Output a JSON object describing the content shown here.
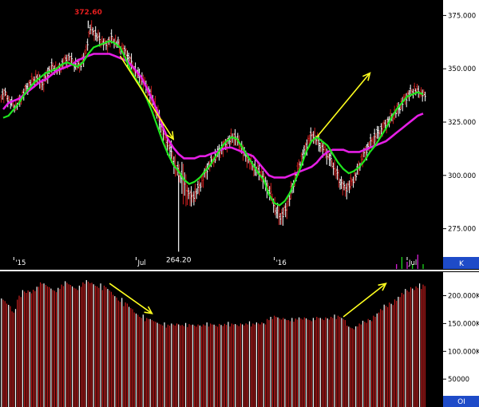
{
  "colors": {
    "background": "#000000",
    "up_bar": "#c81e1e",
    "down_bar": "#ffffff",
    "fast_ma": "#1ee61e",
    "slow_ma": "#e61ee6",
    "arrow": "#ffff1e",
    "axis_panel": "#ffffff",
    "axis_text": "#000000",
    "axis_tag": "#1e4bc8",
    "high_label": "#e61e1e",
    "low_label": "#ffffff",
    "divider": "#ffffff"
  },
  "chart_data": [
    {
      "type": "ohlc",
      "name": "price",
      "grid": false,
      "y_axis_side": "right",
      "ylim": [
        258,
        380
      ],
      "yticks": [
        {
          "value": 375,
          "label": "375.000"
        },
        {
          "value": 350,
          "label": "350.000"
        },
        {
          "value": 325,
          "label": "325.000"
        },
        {
          "value": 300,
          "label": "300.000"
        },
        {
          "value": 275,
          "label": "275.000"
        }
      ],
      "x_ticks": [
        {
          "label": "'15",
          "index": 2
        },
        {
          "label": "Jul",
          "index": 25
        },
        {
          "label": "'16",
          "index": 51
        },
        {
          "label": "Jul",
          "index": 76
        }
      ],
      "axis_tag": "K",
      "annotations": {
        "high": {
          "label": "372.60",
          "value": 372.6,
          "index": 16
        },
        "low": {
          "label": "264.20",
          "value": 264.2,
          "index": 33
        }
      },
      "close": [
        338,
        334,
        332,
        336,
        341,
        344,
        346,
        342,
        348,
        351,
        349,
        353,
        355,
        352,
        351,
        356,
        369,
        366,
        363,
        361,
        364,
        362,
        359,
        356,
        351,
        347,
        344,
        339,
        334,
        326,
        318,
        312,
        304,
        300,
        293,
        289,
        292,
        297,
        303,
        307,
        310,
        313,
        316,
        318,
        315,
        310,
        306,
        303,
        301,
        296,
        291,
        283,
        280,
        285,
        294,
        302,
        309,
        316,
        319,
        315,
        312,
        308,
        303,
        297,
        293,
        296,
        300,
        307,
        312,
        316,
        319,
        322,
        325,
        328,
        331,
        335,
        338,
        340,
        339,
        337
      ],
      "wick": [
        7,
        6,
        5,
        6,
        6,
        6,
        7,
        7,
        8,
        7,
        6,
        6,
        7,
        6,
        6,
        7,
        6,
        7,
        7,
        6,
        7,
        6,
        7,
        8,
        8,
        7,
        8,
        8,
        9,
        10,
        10,
        9,
        11,
        9,
        20,
        10,
        9,
        8,
        8,
        7,
        7,
        8,
        7,
        8,
        8,
        8,
        7,
        8,
        8,
        9,
        9,
        9,
        10,
        9,
        9,
        8,
        8,
        8,
        8,
        8,
        8,
        8,
        8,
        9,
        8,
        8,
        7,
        7,
        8,
        7,
        8,
        7,
        7,
        7,
        7,
        7,
        7,
        6,
        6,
        6
      ],
      "fast_ma": [
        327,
        328,
        331,
        334,
        338,
        341,
        344,
        346,
        348,
        349,
        350,
        352,
        353,
        352,
        351,
        353,
        357,
        360,
        361,
        362,
        363,
        362,
        360,
        355,
        349,
        345,
        341,
        336,
        330,
        323,
        316,
        310,
        305,
        302,
        298,
        296,
        297,
        299,
        302,
        305,
        309,
        313,
        316,
        318,
        317,
        313,
        309,
        305,
        301,
        298,
        291,
        287,
        286,
        288,
        292,
        298,
        304,
        311,
        316,
        318,
        316,
        314,
        310,
        306,
        303,
        301,
        302,
        304,
        307,
        311,
        314,
        318,
        322,
        327,
        331,
        334,
        337,
        338,
        339,
        338
      ],
      "slow_ma": [
        331,
        334,
        335,
        336,
        338,
        340,
        342,
        344,
        345,
        347,
        349,
        350,
        351,
        352,
        354,
        355,
        356,
        357,
        357,
        357,
        357,
        356,
        355,
        354,
        352,
        349,
        346,
        341,
        336,
        330,
        323,
        317,
        313,
        310,
        308,
        308,
        308,
        309,
        309,
        310,
        311,
        312,
        313,
        313,
        312,
        311,
        310,
        309,
        306,
        303,
        300,
        299,
        299,
        299,
        300,
        301,
        302,
        303,
        304,
        306,
        309,
        311,
        312,
        312,
        312,
        311,
        311,
        311,
        312,
        313,
        314,
        315,
        316,
        318,
        320,
        322,
        324,
        326,
        328,
        329
      ],
      "volume_ticks": [
        0,
        0,
        0,
        0,
        0,
        0,
        0,
        0,
        0,
        0,
        0,
        0,
        0,
        0,
        0,
        0,
        0,
        0,
        0,
        0,
        0,
        0,
        0,
        0,
        0,
        0,
        0,
        0,
        0,
        0,
        0,
        0,
        0,
        0,
        0,
        0,
        0,
        0,
        0,
        0,
        0,
        0,
        0,
        0,
        0,
        0,
        0,
        0,
        0,
        0,
        0,
        0,
        0,
        0,
        0,
        0,
        0,
        0,
        0,
        0,
        0,
        0,
        0,
        0,
        0,
        0,
        0,
        0,
        0,
        0,
        0,
        0,
        0,
        0,
        2,
        5,
        3,
        2,
        6,
        2
      ]
    },
    {
      "type": "bar",
      "name": "open_interest",
      "grid": false,
      "y_axis_side": "right",
      "ylim": [
        0,
        238000
      ],
      "yticks": [
        {
          "value": 200000,
          "label": "200.000K"
        },
        {
          "value": 150000,
          "label": "150.000K"
        },
        {
          "value": 100000,
          "label": "100.000K"
        },
        {
          "value": 50000,
          "label": "50000"
        }
      ],
      "axis_tag": "OI",
      "values": [
        195000,
        188000,
        176000,
        200000,
        210000,
        212000,
        216000,
        224000,
        222000,
        218000,
        214000,
        220000,
        226000,
        222000,
        218000,
        224000,
        228000,
        226000,
        222000,
        218000,
        212000,
        204000,
        196000,
        188000,
        180000,
        172000,
        166000,
        160000,
        158000,
        155000,
        152000,
        148000,
        150000,
        152000,
        151000,
        149000,
        148000,
        150000,
        152000,
        150000,
        148000,
        151000,
        153000,
        150000,
        149000,
        152000,
        154000,
        150000,
        152000,
        154000,
        162000,
        164000,
        161000,
        162000,
        160000,
        159000,
        161000,
        163000,
        160000,
        162000,
        160000,
        163000,
        166000,
        164000,
        160000,
        148000,
        145000,
        150000,
        155000,
        160000,
        168000,
        176000,
        184000,
        190000,
        198000,
        205000,
        212000,
        218000,
        222000,
        220000
      ]
    }
  ],
  "arrows": [
    {
      "panel": "price",
      "from": {
        "index": 22,
        "value": 356
      },
      "to": {
        "index": 32,
        "value": 317
      }
    },
    {
      "panel": "price",
      "from": {
        "index": 59,
        "value": 318
      },
      "to": {
        "index": 69,
        "value": 348
      }
    },
    {
      "panel": "open_interest",
      "from": {
        "index": 20,
        "value": 222000
      },
      "to": {
        "index": 28,
        "value": 168000
      }
    },
    {
      "panel": "open_interest",
      "from": {
        "index": 64,
        "value": 162000
      },
      "to": {
        "index": 72,
        "value": 222000
      }
    }
  ]
}
